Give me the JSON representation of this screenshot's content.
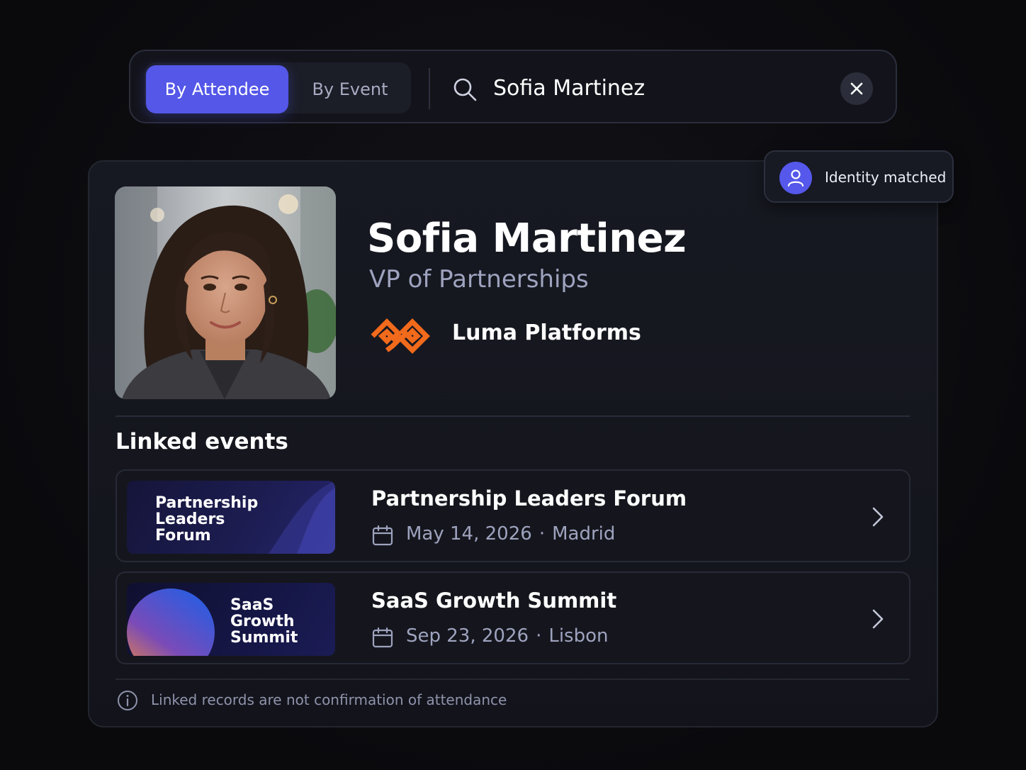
{
  "search": {
    "tabs": [
      {
        "label": "By Attendee",
        "active": true
      },
      {
        "label": "By Event",
        "active": false
      }
    ],
    "query": "Sofia Martinez",
    "clear_icon": "close-icon"
  },
  "badge": {
    "label": "Identity matched",
    "icon": "user-icon"
  },
  "profile": {
    "name": "Sofia Martinez",
    "title": "VP of Partnerships",
    "company": "Luma Platforms",
    "company_logo_color": "#f26a1b"
  },
  "linked_events": {
    "heading": "Linked events",
    "items": [
      {
        "thumb_label": "Partnership\nLeaders\nForum",
        "title": "Partnership Leaders Forum",
        "date": "May 14, 2026",
        "separator": "·",
        "location": "Madrid"
      },
      {
        "thumb_label": "SaaS\nGrowth\nSummit",
        "title": "SaaS Growth Summit",
        "date": "Sep 23, 2026",
        "separator": "·",
        "location": "Lisbon"
      }
    ]
  },
  "footer": {
    "note": "Linked records are not confirmation of attendance",
    "icon": "info-icon"
  },
  "colors": {
    "accent": "#5457e8",
    "background": "#0c0c10",
    "muted_text": "#9ea3bf"
  }
}
